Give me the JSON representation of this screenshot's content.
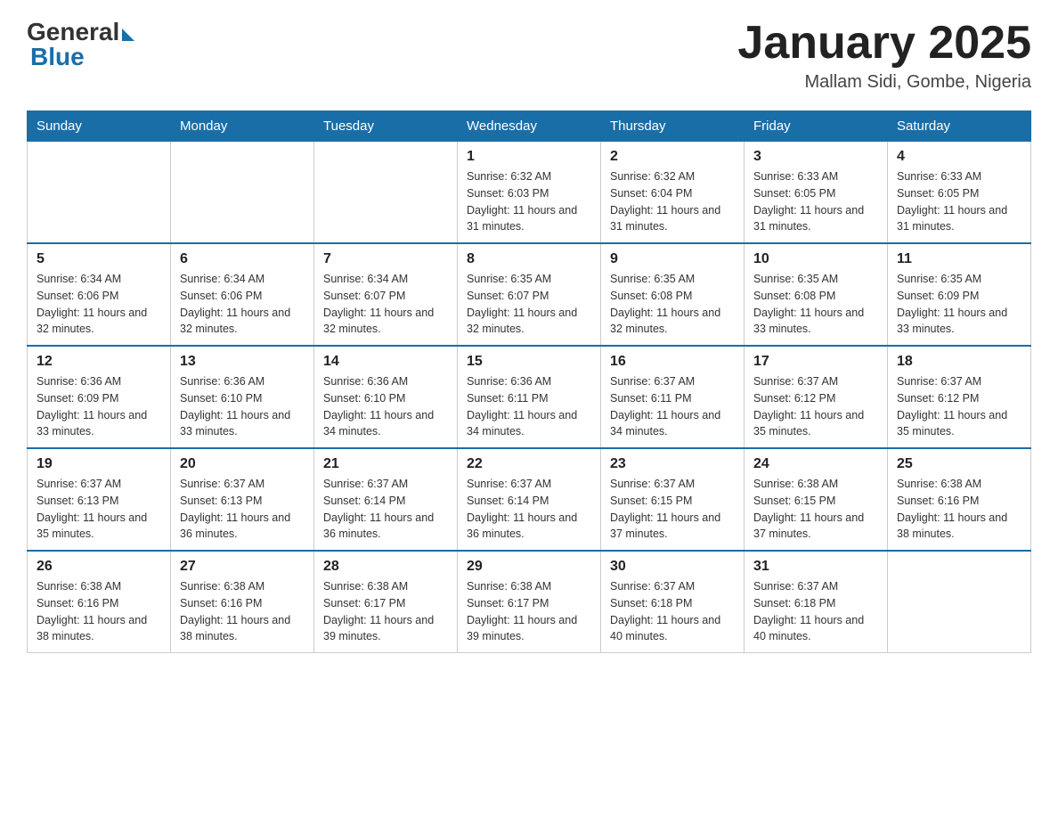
{
  "logo": {
    "general": "General",
    "blue": "Blue"
  },
  "title": "January 2025",
  "location": "Mallam Sidi, Gombe, Nigeria",
  "weekdays": [
    "Sunday",
    "Monday",
    "Tuesday",
    "Wednesday",
    "Thursday",
    "Friday",
    "Saturday"
  ],
  "weeks": [
    [
      {
        "day": "",
        "info": ""
      },
      {
        "day": "",
        "info": ""
      },
      {
        "day": "",
        "info": ""
      },
      {
        "day": "1",
        "info": "Sunrise: 6:32 AM\nSunset: 6:03 PM\nDaylight: 11 hours and 31 minutes."
      },
      {
        "day": "2",
        "info": "Sunrise: 6:32 AM\nSunset: 6:04 PM\nDaylight: 11 hours and 31 minutes."
      },
      {
        "day": "3",
        "info": "Sunrise: 6:33 AM\nSunset: 6:05 PM\nDaylight: 11 hours and 31 minutes."
      },
      {
        "day": "4",
        "info": "Sunrise: 6:33 AM\nSunset: 6:05 PM\nDaylight: 11 hours and 31 minutes."
      }
    ],
    [
      {
        "day": "5",
        "info": "Sunrise: 6:34 AM\nSunset: 6:06 PM\nDaylight: 11 hours and 32 minutes."
      },
      {
        "day": "6",
        "info": "Sunrise: 6:34 AM\nSunset: 6:06 PM\nDaylight: 11 hours and 32 minutes."
      },
      {
        "day": "7",
        "info": "Sunrise: 6:34 AM\nSunset: 6:07 PM\nDaylight: 11 hours and 32 minutes."
      },
      {
        "day": "8",
        "info": "Sunrise: 6:35 AM\nSunset: 6:07 PM\nDaylight: 11 hours and 32 minutes."
      },
      {
        "day": "9",
        "info": "Sunrise: 6:35 AM\nSunset: 6:08 PM\nDaylight: 11 hours and 32 minutes."
      },
      {
        "day": "10",
        "info": "Sunrise: 6:35 AM\nSunset: 6:08 PM\nDaylight: 11 hours and 33 minutes."
      },
      {
        "day": "11",
        "info": "Sunrise: 6:35 AM\nSunset: 6:09 PM\nDaylight: 11 hours and 33 minutes."
      }
    ],
    [
      {
        "day": "12",
        "info": "Sunrise: 6:36 AM\nSunset: 6:09 PM\nDaylight: 11 hours and 33 minutes."
      },
      {
        "day": "13",
        "info": "Sunrise: 6:36 AM\nSunset: 6:10 PM\nDaylight: 11 hours and 33 minutes."
      },
      {
        "day": "14",
        "info": "Sunrise: 6:36 AM\nSunset: 6:10 PM\nDaylight: 11 hours and 34 minutes."
      },
      {
        "day": "15",
        "info": "Sunrise: 6:36 AM\nSunset: 6:11 PM\nDaylight: 11 hours and 34 minutes."
      },
      {
        "day": "16",
        "info": "Sunrise: 6:37 AM\nSunset: 6:11 PM\nDaylight: 11 hours and 34 minutes."
      },
      {
        "day": "17",
        "info": "Sunrise: 6:37 AM\nSunset: 6:12 PM\nDaylight: 11 hours and 35 minutes."
      },
      {
        "day": "18",
        "info": "Sunrise: 6:37 AM\nSunset: 6:12 PM\nDaylight: 11 hours and 35 minutes."
      }
    ],
    [
      {
        "day": "19",
        "info": "Sunrise: 6:37 AM\nSunset: 6:13 PM\nDaylight: 11 hours and 35 minutes."
      },
      {
        "day": "20",
        "info": "Sunrise: 6:37 AM\nSunset: 6:13 PM\nDaylight: 11 hours and 36 minutes."
      },
      {
        "day": "21",
        "info": "Sunrise: 6:37 AM\nSunset: 6:14 PM\nDaylight: 11 hours and 36 minutes."
      },
      {
        "day": "22",
        "info": "Sunrise: 6:37 AM\nSunset: 6:14 PM\nDaylight: 11 hours and 36 minutes."
      },
      {
        "day": "23",
        "info": "Sunrise: 6:37 AM\nSunset: 6:15 PM\nDaylight: 11 hours and 37 minutes."
      },
      {
        "day": "24",
        "info": "Sunrise: 6:38 AM\nSunset: 6:15 PM\nDaylight: 11 hours and 37 minutes."
      },
      {
        "day": "25",
        "info": "Sunrise: 6:38 AM\nSunset: 6:16 PM\nDaylight: 11 hours and 38 minutes."
      }
    ],
    [
      {
        "day": "26",
        "info": "Sunrise: 6:38 AM\nSunset: 6:16 PM\nDaylight: 11 hours and 38 minutes."
      },
      {
        "day": "27",
        "info": "Sunrise: 6:38 AM\nSunset: 6:16 PM\nDaylight: 11 hours and 38 minutes."
      },
      {
        "day": "28",
        "info": "Sunrise: 6:38 AM\nSunset: 6:17 PM\nDaylight: 11 hours and 39 minutes."
      },
      {
        "day": "29",
        "info": "Sunrise: 6:38 AM\nSunset: 6:17 PM\nDaylight: 11 hours and 39 minutes."
      },
      {
        "day": "30",
        "info": "Sunrise: 6:37 AM\nSunset: 6:18 PM\nDaylight: 11 hours and 40 minutes."
      },
      {
        "day": "31",
        "info": "Sunrise: 6:37 AM\nSunset: 6:18 PM\nDaylight: 11 hours and 40 minutes."
      },
      {
        "day": "",
        "info": ""
      }
    ]
  ]
}
